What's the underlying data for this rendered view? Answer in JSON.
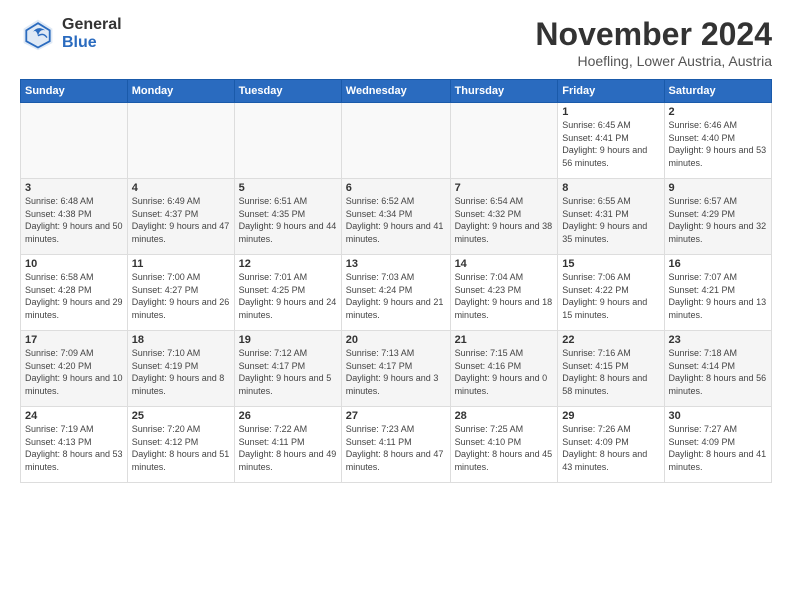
{
  "header": {
    "logo_general": "General",
    "logo_blue": "Blue",
    "title": "November 2024",
    "location": "Hoefling, Lower Austria, Austria"
  },
  "days_of_week": [
    "Sunday",
    "Monday",
    "Tuesday",
    "Wednesday",
    "Thursday",
    "Friday",
    "Saturday"
  ],
  "weeks": [
    [
      {
        "day": "",
        "info": ""
      },
      {
        "day": "",
        "info": ""
      },
      {
        "day": "",
        "info": ""
      },
      {
        "day": "",
        "info": ""
      },
      {
        "day": "",
        "info": ""
      },
      {
        "day": "1",
        "info": "Sunrise: 6:45 AM\nSunset: 4:41 PM\nDaylight: 9 hours and 56 minutes."
      },
      {
        "day": "2",
        "info": "Sunrise: 6:46 AM\nSunset: 4:40 PM\nDaylight: 9 hours and 53 minutes."
      }
    ],
    [
      {
        "day": "3",
        "info": "Sunrise: 6:48 AM\nSunset: 4:38 PM\nDaylight: 9 hours and 50 minutes."
      },
      {
        "day": "4",
        "info": "Sunrise: 6:49 AM\nSunset: 4:37 PM\nDaylight: 9 hours and 47 minutes."
      },
      {
        "day": "5",
        "info": "Sunrise: 6:51 AM\nSunset: 4:35 PM\nDaylight: 9 hours and 44 minutes."
      },
      {
        "day": "6",
        "info": "Sunrise: 6:52 AM\nSunset: 4:34 PM\nDaylight: 9 hours and 41 minutes."
      },
      {
        "day": "7",
        "info": "Sunrise: 6:54 AM\nSunset: 4:32 PM\nDaylight: 9 hours and 38 minutes."
      },
      {
        "day": "8",
        "info": "Sunrise: 6:55 AM\nSunset: 4:31 PM\nDaylight: 9 hours and 35 minutes."
      },
      {
        "day": "9",
        "info": "Sunrise: 6:57 AM\nSunset: 4:29 PM\nDaylight: 9 hours and 32 minutes."
      }
    ],
    [
      {
        "day": "10",
        "info": "Sunrise: 6:58 AM\nSunset: 4:28 PM\nDaylight: 9 hours and 29 minutes."
      },
      {
        "day": "11",
        "info": "Sunrise: 7:00 AM\nSunset: 4:27 PM\nDaylight: 9 hours and 26 minutes."
      },
      {
        "day": "12",
        "info": "Sunrise: 7:01 AM\nSunset: 4:25 PM\nDaylight: 9 hours and 24 minutes."
      },
      {
        "day": "13",
        "info": "Sunrise: 7:03 AM\nSunset: 4:24 PM\nDaylight: 9 hours and 21 minutes."
      },
      {
        "day": "14",
        "info": "Sunrise: 7:04 AM\nSunset: 4:23 PM\nDaylight: 9 hours and 18 minutes."
      },
      {
        "day": "15",
        "info": "Sunrise: 7:06 AM\nSunset: 4:22 PM\nDaylight: 9 hours and 15 minutes."
      },
      {
        "day": "16",
        "info": "Sunrise: 7:07 AM\nSunset: 4:21 PM\nDaylight: 9 hours and 13 minutes."
      }
    ],
    [
      {
        "day": "17",
        "info": "Sunrise: 7:09 AM\nSunset: 4:20 PM\nDaylight: 9 hours and 10 minutes."
      },
      {
        "day": "18",
        "info": "Sunrise: 7:10 AM\nSunset: 4:19 PM\nDaylight: 9 hours and 8 minutes."
      },
      {
        "day": "19",
        "info": "Sunrise: 7:12 AM\nSunset: 4:17 PM\nDaylight: 9 hours and 5 minutes."
      },
      {
        "day": "20",
        "info": "Sunrise: 7:13 AM\nSunset: 4:17 PM\nDaylight: 9 hours and 3 minutes."
      },
      {
        "day": "21",
        "info": "Sunrise: 7:15 AM\nSunset: 4:16 PM\nDaylight: 9 hours and 0 minutes."
      },
      {
        "day": "22",
        "info": "Sunrise: 7:16 AM\nSunset: 4:15 PM\nDaylight: 8 hours and 58 minutes."
      },
      {
        "day": "23",
        "info": "Sunrise: 7:18 AM\nSunset: 4:14 PM\nDaylight: 8 hours and 56 minutes."
      }
    ],
    [
      {
        "day": "24",
        "info": "Sunrise: 7:19 AM\nSunset: 4:13 PM\nDaylight: 8 hours and 53 minutes."
      },
      {
        "day": "25",
        "info": "Sunrise: 7:20 AM\nSunset: 4:12 PM\nDaylight: 8 hours and 51 minutes."
      },
      {
        "day": "26",
        "info": "Sunrise: 7:22 AM\nSunset: 4:11 PM\nDaylight: 8 hours and 49 minutes."
      },
      {
        "day": "27",
        "info": "Sunrise: 7:23 AM\nSunset: 4:11 PM\nDaylight: 8 hours and 47 minutes."
      },
      {
        "day": "28",
        "info": "Sunrise: 7:25 AM\nSunset: 4:10 PM\nDaylight: 8 hours and 45 minutes."
      },
      {
        "day": "29",
        "info": "Sunrise: 7:26 AM\nSunset: 4:09 PM\nDaylight: 8 hours and 43 minutes."
      },
      {
        "day": "30",
        "info": "Sunrise: 7:27 AM\nSunset: 4:09 PM\nDaylight: 8 hours and 41 minutes."
      }
    ]
  ]
}
